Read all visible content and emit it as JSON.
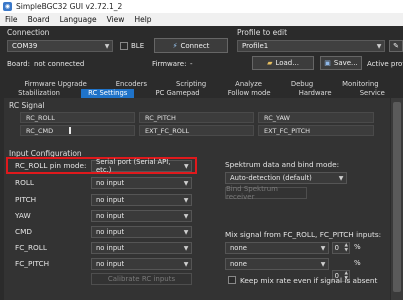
{
  "window": {
    "title": "SimpleBGC32 GUI v2.72.1_2"
  },
  "menu": [
    "File",
    "Board",
    "Language",
    "View",
    "Help"
  ],
  "connection": {
    "label": "Connection",
    "port": "COM39",
    "ble_label": "BLE",
    "connect_label": "Connect",
    "board_label": "Board:",
    "board_value": "not connected",
    "firmware_label": "Firmware:",
    "firmware_value": "-"
  },
  "profile": {
    "label": "Profile to edit",
    "value": "Profile1",
    "load_label": "Load...",
    "save_label": "Save...",
    "active_label": "Active profi"
  },
  "tabs_top": [
    "Firmware Upgrade",
    "Encoders",
    "Scripting",
    "Analyze",
    "Debug",
    "Monitoring"
  ],
  "tabs_bottom": [
    "Stabilization",
    "RC Settings",
    "PC Gamepad",
    "Follow mode",
    "Hardware",
    "Service"
  ],
  "active_tab": "RC Settings",
  "rc_signal": {
    "label": "RC Signal",
    "cells": [
      "RC_ROLL",
      "RC_PITCH",
      "RC_YAW",
      "RC_CMD",
      "EXT_FC_ROLL",
      "EXT_FC_PITCH"
    ]
  },
  "input_config": {
    "label": "Input Configuration",
    "pin_mode_label": "RC_ROLL pin mode:",
    "pin_mode_value": "Serial port (Serial API, etc.)",
    "rows": [
      {
        "label": "ROLL",
        "value": "no input"
      },
      {
        "label": "PITCH",
        "value": "no input"
      },
      {
        "label": "YAW",
        "value": "no input"
      },
      {
        "label": "CMD",
        "value": "no input"
      },
      {
        "label": "FC_ROLL",
        "value": "no input"
      },
      {
        "label": "FC_PITCH",
        "value": "no input"
      }
    ],
    "calibrate_label": "Calibrate RC inputs"
  },
  "spektrum": {
    "label": "Spektrum data and bind mode:",
    "value": "Auto-detection (default)",
    "bind_label": "Bind Spektrum receiver"
  },
  "mix": {
    "label": "Mix signal from FC_ROLL, FC_PITCH inputs:",
    "rows": [
      {
        "value": "none",
        "percent": "0",
        "unit": "%"
      },
      {
        "value": "none",
        "percent": "0",
        "unit": "%"
      }
    ],
    "keep_label": "Keep mix rate even if signal is absent"
  }
}
